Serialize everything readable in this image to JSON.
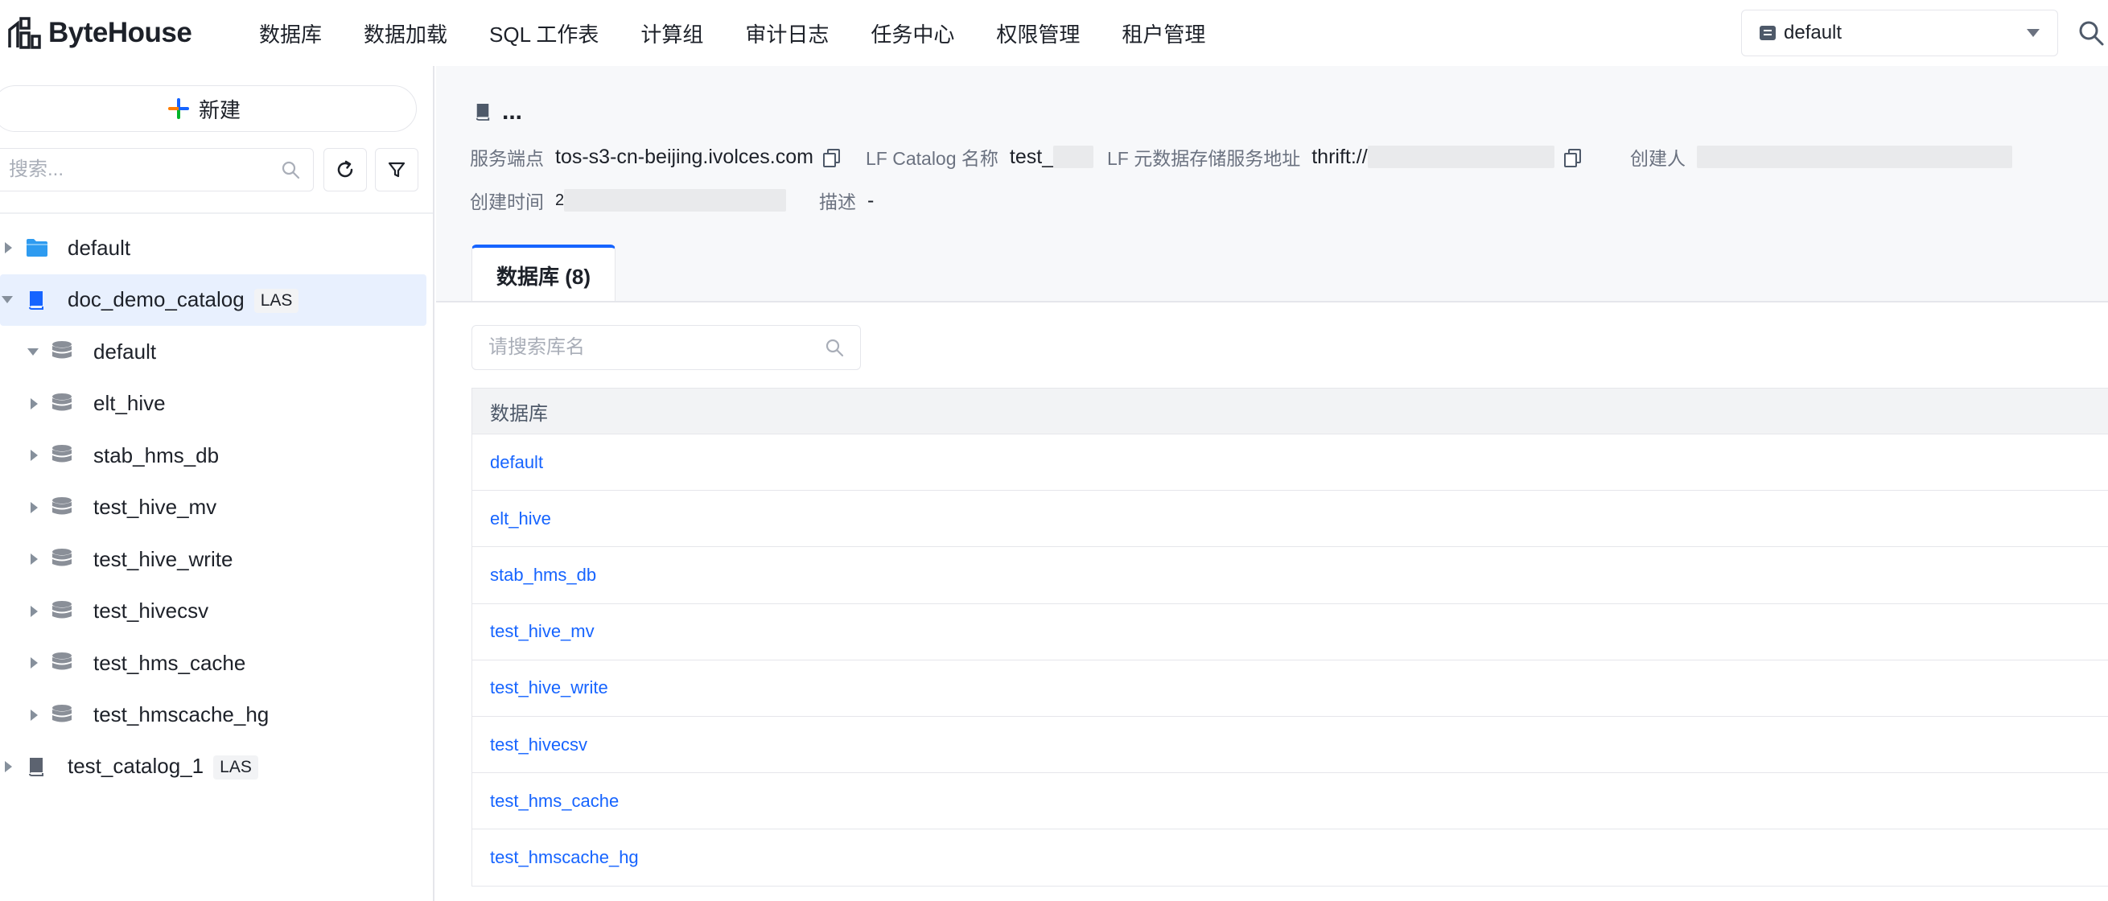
{
  "app": {
    "logo_text": "ByteHouse"
  },
  "nav": {
    "items": [
      "数据库",
      "数据加载",
      "SQL 工作表",
      "计算组",
      "审计日志",
      "任务中心",
      "权限管理",
      "租户管理"
    ]
  },
  "env_select": {
    "value": "default"
  },
  "sidebar": {
    "new_label": "新建",
    "search_placeholder": "搜索...",
    "tree": [
      {
        "label": "default",
        "type": "folder",
        "expanded": false
      },
      {
        "label": "doc_demo_catalog",
        "type": "catalog",
        "tag": "LAS",
        "expanded": true,
        "selected": true
      },
      {
        "label": "default",
        "type": "database",
        "expanded": true
      },
      {
        "label": "elt_hive",
        "type": "database",
        "expanded": false
      },
      {
        "label": "stab_hms_db",
        "type": "database",
        "expanded": false
      },
      {
        "label": "test_hive_mv",
        "type": "database",
        "expanded": false
      },
      {
        "label": "test_hive_write",
        "type": "database",
        "expanded": false
      },
      {
        "label": "test_hivecsv",
        "type": "database",
        "expanded": false
      },
      {
        "label": "test_hms_cache",
        "type": "database",
        "expanded": false
      },
      {
        "label": "test_hmscache_hg",
        "type": "database",
        "expanded": false
      },
      {
        "label": "test_catalog_1",
        "type": "catalog",
        "tag": "LAS",
        "expanded": false
      }
    ]
  },
  "detail": {
    "title": "...",
    "meta": {
      "endpoint_label": "服务端点",
      "endpoint_value": "tos-s3-cn-beijing.ivolces.com",
      "lf_name_label": "LF Catalog 名称",
      "lf_name_value": "test_",
      "lf_addr_label": "LF 元数据存储服务地址",
      "lf_addr_value": "thrift://",
      "creator_label": "创建人",
      "created_label": "创建时间",
      "created_value": "2",
      "desc_label": "描述",
      "desc_value": "-"
    },
    "tab_label": "数据库 (8)",
    "search_placeholder": "请搜索库名",
    "table": {
      "header": "数据库",
      "rows": [
        "default",
        "elt_hive",
        "stab_hms_db",
        "test_hive_mv",
        "test_hive_write",
        "test_hivecsv",
        "test_hms_cache",
        "test_hmscache_hg"
      ]
    }
  },
  "colors": {
    "accent": "#1664ff",
    "selected_bg": "#e8f0fe",
    "folder": "#2e9bf0"
  }
}
